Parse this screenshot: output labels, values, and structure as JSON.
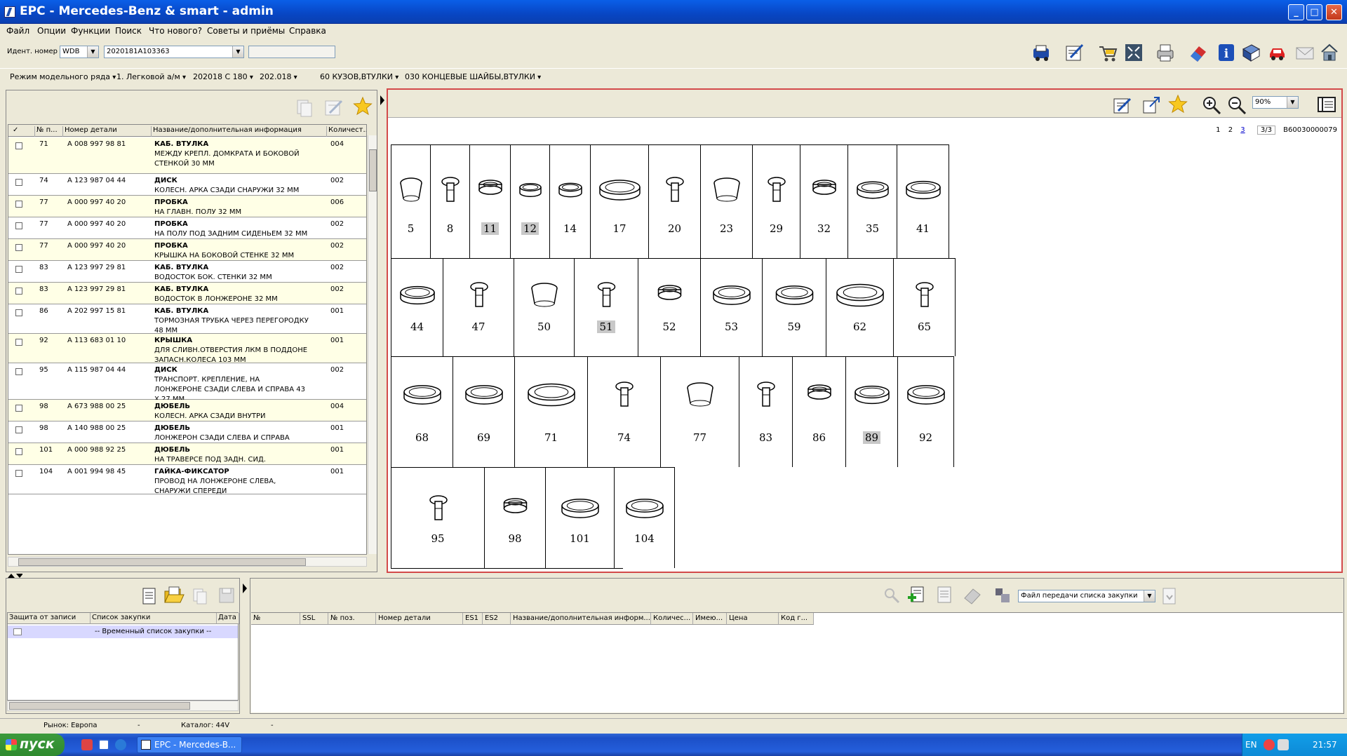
{
  "window": {
    "title": "EPC - Mercedes-Benz & smart - admin"
  },
  "menu": [
    "Файл",
    "Опции",
    "Функции",
    "Поиск",
    "Что нового?",
    "Советы и приёмы",
    "Справка"
  ],
  "ident": {
    "label": "Идент. номер",
    "prefix": "WDB",
    "value": "2020181A103363",
    "extra": ""
  },
  "selectors": [
    "Режим модельного ряда",
    "1. Легковой а/м",
    "202018 C 180",
    "202.018",
    "60 КУЗОВ,ВТУЛКИ",
    "030 КОНЦЕВЫЕ ШАЙБЫ,ВТУЛКИ"
  ],
  "parts_table": {
    "headers": [
      "✓",
      "№ п...",
      "Номер детали",
      "Название/дополнительная информация",
      "Количест..."
    ],
    "rows": [
      {
        "pos": "71",
        "part": "A 008 997 98 81",
        "name": "КАБ. ВТУЛКА",
        "desc": "МЕЖДУ КРЕПЛ. ДОМКРАТА И БОКОВОЙ СТЕНКОЙ 30 ММ",
        "qty": "004"
      },
      {
        "pos": "74",
        "part": "A 123 987 04 44",
        "name": "ДИСК",
        "desc": "КОЛЕСН. АРКА СЗАДИ СНАРУЖИ 32 ММ",
        "qty": "002"
      },
      {
        "pos": "77",
        "part": "A 000 997 40 20",
        "name": "ПРОБКА",
        "desc": "НА ГЛАВН. ПОЛУ 32 ММ",
        "qty": "006"
      },
      {
        "pos": "77",
        "part": "A 000 997 40 20",
        "name": "ПРОБКА",
        "desc": "НА ПОЛУ ПОД ЗАДНИМ СИДЕНЬЕМ 32 ММ",
        "qty": "002"
      },
      {
        "pos": "77",
        "part": "A 000 997 40 20",
        "name": "ПРОБКА",
        "desc": "КРЫШКА НА БОКОВОЙ СТЕНКЕ 32 ММ",
        "qty": "002"
      },
      {
        "pos": "83",
        "part": "A 123 997 29 81",
        "name": "КАБ. ВТУЛКА",
        "desc": "ВОДОСТОК БОК. СТЕНКИ 32 ММ",
        "qty": "002"
      },
      {
        "pos": "83",
        "part": "A 123 997 29 81",
        "name": "КАБ. ВТУЛКА",
        "desc": "ВОДОСТОК В ЛОНЖЕРОНЕ 32 ММ",
        "qty": "002"
      },
      {
        "pos": "86",
        "part": "A 202 997 15 81",
        "name": "КАБ. ВТУЛКА",
        "desc": "ТОРМОЗНАЯ ТРУБКА ЧЕРЕЗ ПЕРЕГОРОДКУ 48 ММ",
        "qty": "001"
      },
      {
        "pos": "92",
        "part": "A 113 683 01 10",
        "name": "КРЫШКА",
        "desc": "ДЛЯ СЛИВН.ОТВЕРСТИЯ ЛКМ В ПОДДОНЕ ЗАПАСН.КОЛЕСА 103 ММ",
        "qty": "001"
      },
      {
        "pos": "95",
        "part": "A 115 987 04 44",
        "name": "ДИСК",
        "desc": "ТРАНСПОРТ. КРЕПЛЕНИЕ, НА ЛОНЖЕРОНЕ СЗАДИ СЛЕВА И СПРАВА 43 X 27 MM",
        "qty": "002"
      },
      {
        "pos": "98",
        "part": "A 673 988 00 25",
        "name": "ДЮБЕЛЬ",
        "desc": "КОЛЕСН. АРКА СЗАДИ ВНУТРИ",
        "qty": "004"
      },
      {
        "pos": "98",
        "part": "A 140 988 00 25",
        "name": "ДЮБЕЛЬ",
        "desc": "ЛОНЖЕРОН СЗАДИ СЛЕВА И СПРАВА",
        "qty": "001"
      },
      {
        "pos": "101",
        "part": "A 000 988 92 25",
        "name": "ДЮБЕЛЬ",
        "desc": "НА ТРАВЕРСЕ ПОД ЗАДН. СИД.",
        "qty": "001"
      },
      {
        "pos": "104",
        "part": "A 001 994 98 45",
        "name": "ГАЙКА-ФИКСАТОР",
        "desc": "ПРОВОД НА ЛОНЖЕРОНЕ СЛЕВА, СНАРУЖИ СПЕРЕДИ",
        "qty": "001"
      }
    ]
  },
  "viewer": {
    "zoom": "90%",
    "pages": [
      "1",
      "2",
      "3"
    ],
    "page_of": "3/3",
    "doc_id": "B60030000079"
  },
  "drawing": {
    "rows": [
      [
        "5",
        "8",
        "11",
        "12",
        "14",
        "17",
        "20",
        "23",
        "29",
        "32",
        "35",
        "41"
      ],
      [
        "44",
        "47",
        "50",
        "51",
        "52",
        "53",
        "59",
        "62",
        "65"
      ],
      [
        "68",
        "69",
        "71",
        "74",
        "77",
        "83",
        "86",
        "89",
        "92"
      ],
      [
        "95",
        "98",
        "101",
        "104"
      ]
    ],
    "highlighted": [
      "11",
      "12",
      "51",
      "89"
    ]
  },
  "shopping": {
    "headers": [
      "Защита от записи",
      "Список закупки",
      "Дата"
    ],
    "row": "-- Временный список закупки --"
  },
  "order": {
    "headers": [
      "№",
      "SSL",
      "№ поз.",
      "Номер детали",
      "ES1",
      "ES2",
      "Название/дополнительная информ...",
      "Количес...",
      "Имею...",
      "Цена",
      "Код г..."
    ],
    "transfer": "Файл передачи списка закупки"
  },
  "status": {
    "market": "Рынок: Европа",
    "sep1": "-",
    "catalog": "Каталог: 44V",
    "sep2": "-"
  },
  "taskbar": {
    "start": "пуск",
    "task": "EPC - Mercedes-B...",
    "lang": "EN",
    "time": "21:57"
  }
}
